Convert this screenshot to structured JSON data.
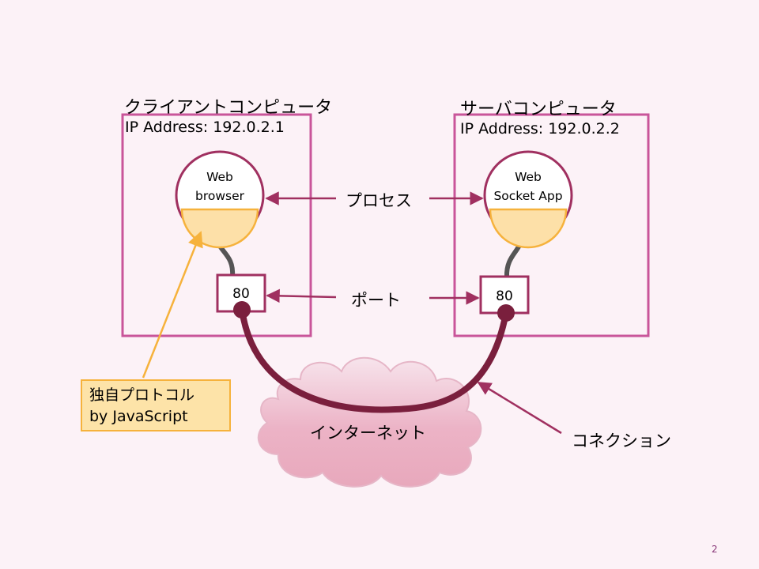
{
  "client": {
    "title": "クライアントコンピュータ",
    "ip": "IP Address: 192.0.2.1",
    "process_line1": "Web",
    "process_line2": "browser",
    "port": "80"
  },
  "server": {
    "title": "サーバコンピュータ",
    "ip": "IP Address: 192.0.2.2",
    "process_line1": "Web",
    "process_line2": "Socket App",
    "port": "80"
  },
  "labels": {
    "process": "プロセス",
    "port": "ポート",
    "internet": "インターネット",
    "connection": "コネクション"
  },
  "note": {
    "line1": "独自プロトコル",
    "line2": "by JavaScript"
  },
  "page_number": "2",
  "colors": {
    "background": "#fcf2f7",
    "box_border": "#c9559a",
    "arrow": "#a03060",
    "cable": "#7a1f3d",
    "process_fill": "#fde0a8",
    "note_border": "#f6b23c",
    "cloud": "#e8a8bc"
  }
}
